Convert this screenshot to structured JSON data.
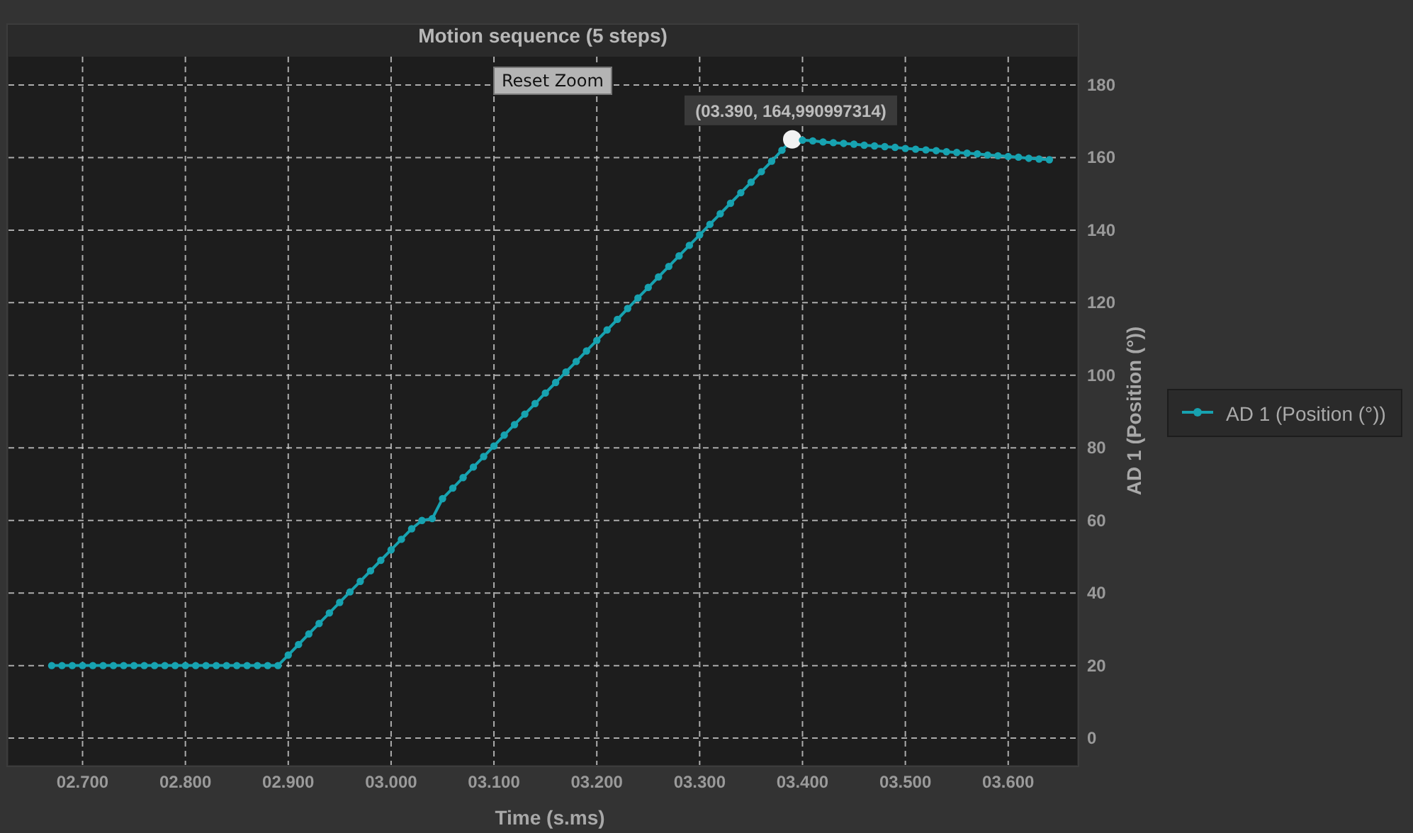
{
  "chart": {
    "reset_zoom_button": "Reset Zoom",
    "chart_data": {
      "type": "line",
      "title": "Motion sequence (5 steps)",
      "xlabel": "Time (s.ms)",
      "ylabel": "AD 1 (Position (°))",
      "xlim": [
        2.628,
        3.667
      ],
      "ylim": [
        -7.4,
        187.8
      ],
      "xticks": [
        {
          "value": 2.7,
          "label": "02.700"
        },
        {
          "value": 2.8,
          "label": "02.800"
        },
        {
          "value": 2.9,
          "label": "02.900"
        },
        {
          "value": 3.0,
          "label": "03.000"
        },
        {
          "value": 3.1,
          "label": "03.100"
        },
        {
          "value": 3.2,
          "label": "03.200"
        },
        {
          "value": 3.3,
          "label": "03.300"
        },
        {
          "value": 3.4,
          "label": "03.400"
        },
        {
          "value": 3.5,
          "label": "03.500"
        },
        {
          "value": 3.6,
          "label": "03.600"
        }
      ],
      "yticks": [
        0,
        20,
        40,
        60,
        80,
        100,
        120,
        140,
        160,
        180
      ],
      "x": [
        2.67,
        2.68,
        2.69,
        2.7,
        2.71,
        2.72,
        2.73,
        2.74,
        2.75,
        2.76,
        2.77,
        2.78,
        2.79,
        2.8,
        2.81,
        2.82,
        2.83,
        2.84,
        2.85,
        2.86,
        2.87,
        2.88,
        2.89,
        2.9,
        2.91,
        2.92,
        2.93,
        2.94,
        2.95,
        2.96,
        2.97,
        2.98,
        2.99,
        3.0,
        3.01,
        3.02,
        3.03,
        3.04,
        3.05,
        3.06,
        3.07,
        3.08,
        3.09,
        3.1,
        3.11,
        3.12,
        3.13,
        3.14,
        3.15,
        3.16,
        3.17,
        3.18,
        3.19,
        3.2,
        3.21,
        3.22,
        3.23,
        3.24,
        3.25,
        3.26,
        3.27,
        3.28,
        3.29,
        3.3,
        3.31,
        3.32,
        3.33,
        3.34,
        3.35,
        3.36,
        3.37,
        3.38,
        3.39,
        3.4,
        3.41,
        3.42,
        3.43,
        3.44,
        3.45,
        3.46,
        3.47,
        3.48,
        3.49,
        3.5,
        3.51,
        3.52,
        3.53,
        3.54,
        3.55,
        3.56,
        3.57,
        3.58,
        3.59,
        3.6,
        3.61,
        3.62,
        3.63,
        3.64
      ],
      "series": [
        {
          "name": "AD 1 (Position (°))",
          "color": "#17a2b0",
          "marker": "circle",
          "values": [
            20,
            20,
            20,
            20,
            20,
            20,
            20,
            20,
            20,
            20,
            20,
            20,
            20,
            20,
            20,
            20,
            20,
            20,
            20,
            20,
            20,
            20,
            20,
            22.9,
            25.8,
            28.7,
            31.6,
            34.5,
            37.4,
            40.3,
            43.2,
            46.1,
            49.0,
            51.9,
            54.8,
            57.7,
            60.0,
            60.5,
            66.0,
            68.9,
            71.8,
            74.7,
            77.6,
            80.5,
            83.5,
            86.4,
            89.3,
            92.2,
            95.1,
            98.0,
            100.9,
            103.8,
            106.7,
            109.6,
            112.5,
            115.4,
            118.4,
            121.3,
            124.2,
            127.1,
            130.0,
            132.9,
            135.8,
            138.7,
            141.6,
            144.5,
            147.4,
            150.3,
            153.2,
            156.1,
            159.0,
            162.0,
            165.0,
            164.8,
            164.6,
            164.3,
            164.1,
            163.9,
            163.7,
            163.4,
            163.2,
            163.0,
            162.8,
            162.5,
            162.3,
            162.1,
            161.9,
            161.6,
            161.4,
            161.2,
            161.0,
            160.7,
            160.5,
            160.3,
            160.1,
            159.8,
            159.6,
            159.4
          ]
        }
      ],
      "grid": true,
      "annotations": [
        {
          "x": 3.39,
          "y": 165.0,
          "text": "(03.390, 164,990997314)"
        }
      ]
    }
  }
}
